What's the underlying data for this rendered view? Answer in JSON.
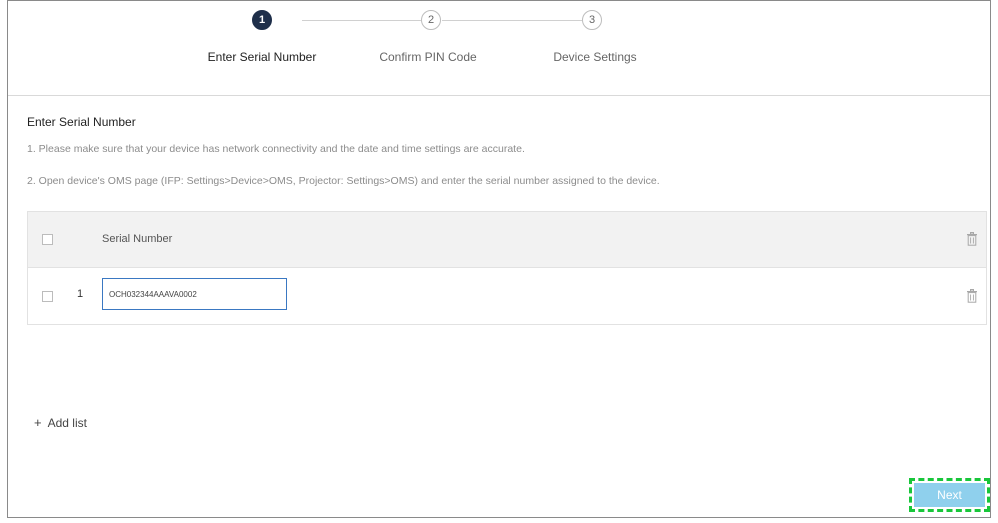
{
  "stepper": {
    "steps": [
      {
        "number": "1",
        "label": "Enter Serial Number",
        "state": "active"
      },
      {
        "number": "2",
        "label": "Confirm PIN Code",
        "state": "todo"
      },
      {
        "number": "3",
        "label": "Device Settings",
        "state": "todo"
      }
    ]
  },
  "section": {
    "title": "Enter Serial Number",
    "instructions": [
      "1. Please make sure that your device has network connectivity and the date and time settings are accurate.",
      "2. Open device's OMS page (IFP: Settings>Device>OMS, Projector: Settings>OMS) and enter the serial number assigned to the device."
    ]
  },
  "table": {
    "header": "Serial Number",
    "rows": [
      {
        "index": "1",
        "serial": "OCH032344AAAVA0002"
      }
    ]
  },
  "actions": {
    "add_list": "Add list",
    "add_list_icon": "+",
    "next": "Next"
  },
  "colors": {
    "step_active": "#1f2f4a",
    "next_button": "#8fd0ed",
    "highlight_border": "#18c63a",
    "input_border": "#3a78c2"
  }
}
